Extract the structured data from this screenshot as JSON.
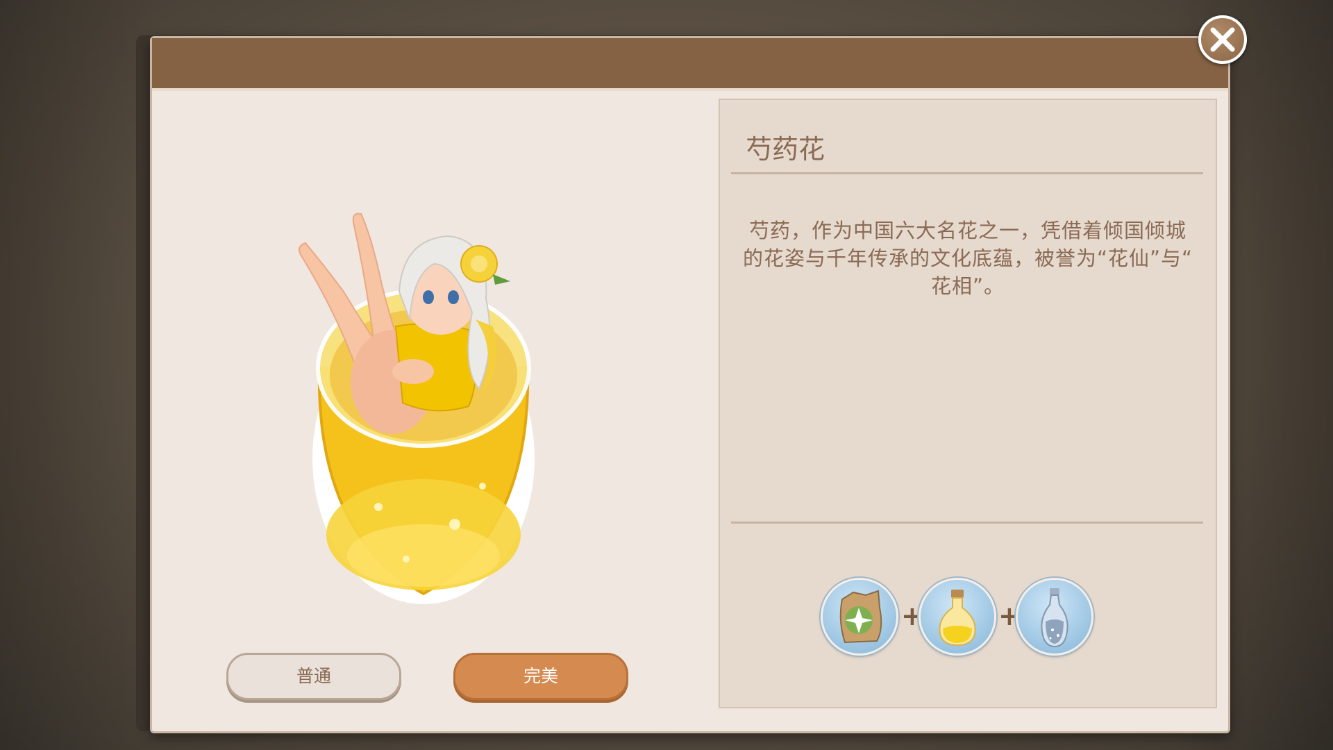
{
  "dialog": {
    "close_icon": "close-x-icon",
    "item_name": "芍药花",
    "description": "芍药，作为中国六大名花之一，凭借着倾国倾城的花姿与千年传承的文化底蕴，被誉为“花仙”与“花相”。",
    "description_lines": [
      "芍药，作为中国六大名花之一，凭借着倾国倾城",
      "的花姿与千年传承的文化底蕴，被誉为“花仙”与“",
      "花相”。"
    ],
    "buttons": {
      "normal": "普通",
      "perfect": "完美"
    },
    "character_art": "anime girl sitting in a glass of yellow drink with a yellow flower in her hair",
    "recipe": {
      "ingredients": [
        {
          "icon": "flower-seed-bag-icon"
        },
        {
          "icon": "yellow-potion-bottle-icon"
        },
        {
          "icon": "sparkle-vase-icon"
        }
      ],
      "separator": "+"
    }
  },
  "colors": {
    "header": "#856243",
    "panel_bg": "#efe7e0",
    "info_bg": "#e6d9cd",
    "text": "#8a6a54",
    "perfect_button": "#d58a50",
    "normal_button": "#e9e1da"
  }
}
